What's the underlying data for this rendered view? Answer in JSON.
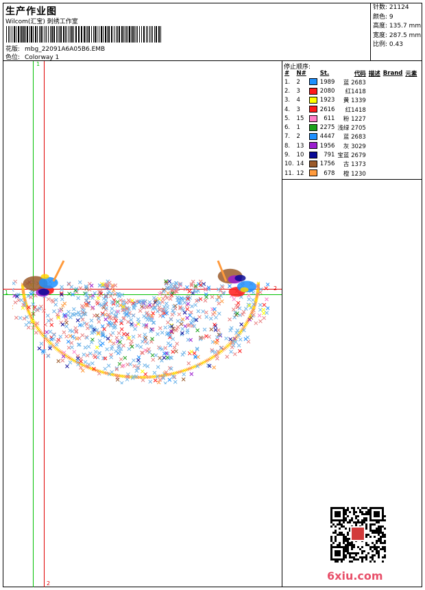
{
  "header": {
    "title": "生产作业图",
    "company": "Wilcom(汇宝) 刺绣工作室",
    "file_label": "花版:",
    "file_name": "mbg_22091A6A05B6.EMB",
    "colorway_label": "色位:",
    "colorway_name": "Colorway 1"
  },
  "stats": [
    {
      "label": "针数:",
      "value": "21124"
    },
    {
      "label": "颜色:",
      "value": "9"
    },
    {
      "label": "高度:",
      "value": "135.7 mm"
    },
    {
      "label": "宽度:",
      "value": "287.5 mm"
    },
    {
      "label": "比例:",
      "value": "0.43"
    }
  ],
  "stop_sequence": {
    "title": "停止顺序:",
    "headers": [
      "#",
      "N#",
      "St.",
      "代码",
      "描述",
      "Brand",
      "元素"
    ],
    "rows": [
      {
        "idx": "1.",
        "n": "2",
        "color": "#1e90ff",
        "st": "1989",
        "code": "蓝 2683"
      },
      {
        "idx": "2.",
        "n": "3",
        "color": "#ff1a1a",
        "st": "2080",
        "code": "红1418"
      },
      {
        "idx": "3.",
        "n": "4",
        "color": "#ffff00",
        "st": "1923",
        "code": "黄 1339"
      },
      {
        "idx": "4.",
        "n": "3",
        "color": "#ff1a1a",
        "st": "2616",
        "code": "红1418"
      },
      {
        "idx": "5.",
        "n": "15",
        "color": "#ff7ec8",
        "st": "611",
        "code": "粉 1227"
      },
      {
        "idx": "6.",
        "n": "1",
        "color": "#1aa01a",
        "st": "2275",
        "code": "浅绿 2705"
      },
      {
        "idx": "7.",
        "n": "2",
        "color": "#1e90ff",
        "st": "4447",
        "code": "蓝 2683"
      },
      {
        "idx": "8.",
        "n": "13",
        "color": "#9b1dcf",
        "st": "1956",
        "code": "灰 3029"
      },
      {
        "idx": "9.",
        "n": "10",
        "color": "#0a0a96",
        "st": "791",
        "code": "宝蓝 2679"
      },
      {
        "idx": "10.",
        "n": "14",
        "color": "#9a5a2a",
        "st": "1756",
        "code": "古 1373"
      },
      {
        "idx": "11.",
        "n": "12",
        "color": "#ff9a3c",
        "st": "678",
        "code": "橙 1230"
      }
    ]
  },
  "guides": {
    "v1_label": "1",
    "v2_label": "2",
    "h1_label": "1",
    "h2_label": "2",
    "green": "#00c000",
    "red": "#e00000"
  },
  "watermark": "6xiu.com"
}
